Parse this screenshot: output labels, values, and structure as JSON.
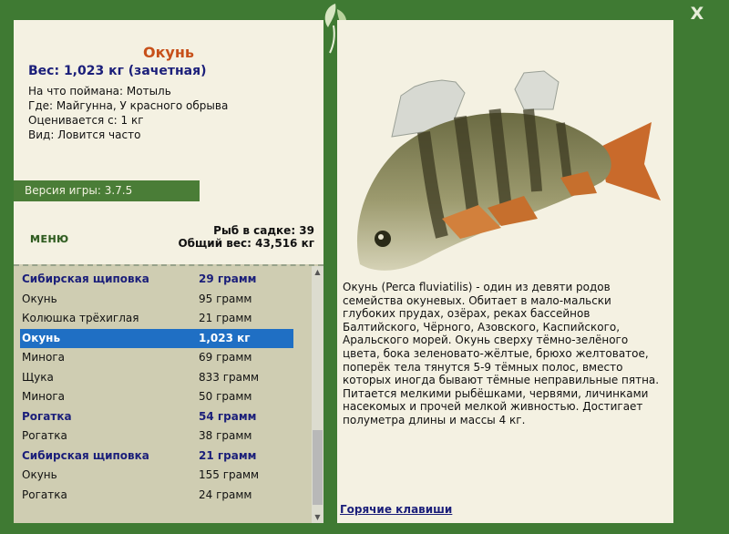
{
  "close_label": "X",
  "fish": {
    "name": "Окунь",
    "weight_line": "Вес: 1,023 кг (зачетная)",
    "caught_with": "На что поймана: Мотыль",
    "location": "Где: Майгунна, У красного обрыва",
    "counts_from": "Оценивается с: 1 кг",
    "kind": "Вид: Ловится часто"
  },
  "version": "Версия игры: 3.7.5",
  "menu_label": "МЕНЮ",
  "stats": {
    "count_line": "Рыб в садке: 39",
    "total_line": "Общий вес: 43,516 кг"
  },
  "catch_list": [
    {
      "name": "Сибирская щиповка",
      "weight": "29 грамм",
      "style": "bold"
    },
    {
      "name": "Окунь",
      "weight": "95 грамм",
      "style": "normal"
    },
    {
      "name": "Колюшка трёхиглая",
      "weight": "21 грамм",
      "style": "normal"
    },
    {
      "name": "Окунь",
      "weight": "1,023 кг",
      "style": "selected"
    },
    {
      "name": "Минога",
      "weight": "69 грамм",
      "style": "normal"
    },
    {
      "name": "Щука",
      "weight": "833 грамм",
      "style": "normal"
    },
    {
      "name": "Минога",
      "weight": "50 грамм",
      "style": "normal"
    },
    {
      "name": "Рогатка",
      "weight": "54 грамм",
      "style": "bold"
    },
    {
      "name": "Рогатка",
      "weight": "38 грамм",
      "style": "normal"
    },
    {
      "name": "Сибирская щиповка",
      "weight": "21 грамм",
      "style": "bold"
    },
    {
      "name": "Окунь",
      "weight": "155 грамм",
      "style": "normal"
    },
    {
      "name": "Рогатка",
      "weight": "24 грамм",
      "style": "normal"
    }
  ],
  "description": "Окунь (Perca fluviatilis) - один из девяти родов семейства окуневых. Обитает в мало-мальски глубоких прудах, озёрах, реках бассейнов Балтийского, Чёрного, Азовского, Каспийского, Аральского морей. Окунь сверху тёмно-зелёного цвета, бока зеленовато-жёлтые, брюхо желтоватое, поперёк тела тянутся 5-9 тёмных полос, вместо которых иногда бывают тёмные неправильные пятна. Питается мелкими рыбёшками, червями, личинками насекомых и прочей мелкой живностью. Достигает полуметра длины и массы 4 кг.",
  "hotkeys_label": "Горячие клавиши",
  "colors": {
    "frame": "#3f7a33",
    "panel": "#f4f1e2",
    "list_bg": "#cfcdb2",
    "accent_orange": "#c7501a",
    "navy": "#1b1f7a",
    "selection": "#1f6fc4"
  }
}
